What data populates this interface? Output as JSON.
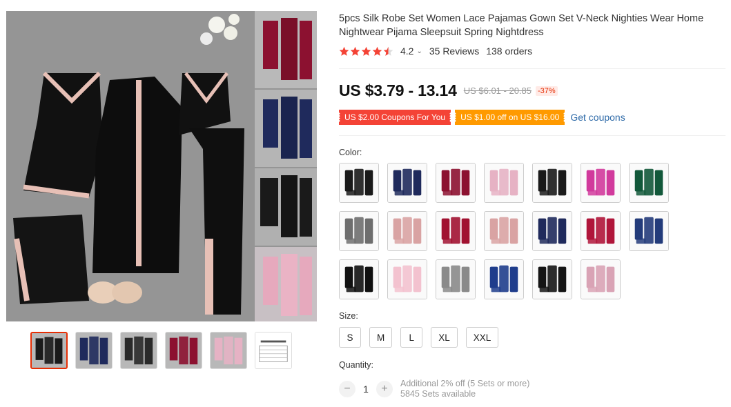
{
  "product": {
    "title": "5pcs Silk Robe Set Women Lace Pajamas Gown Set V-Neck Nighties Wear Home Nightwear Pijama Sleepsuit Spring Nightdress",
    "rating": "4.2",
    "reviews": "35 Reviews",
    "orders": "138 orders",
    "price": "US $3.79 - 13.14",
    "old_price": "US $6.01 - 20.85",
    "discount": "-37%"
  },
  "coupons": {
    "coupon1": "US $2.00 Coupons For You",
    "coupon2": "US $1.00 off on US $16.00",
    "get_coupons": "Get coupons"
  },
  "color": {
    "label": "Color:",
    "swatches": [
      "#1a1a1a",
      "#1f2a5c",
      "#8c1130",
      "#e6b2c4",
      "#1a1a1a",
      "#d13a9c",
      "#12583a",
      "#6e6e6e",
      "#d9a3a3",
      "#a11231",
      "#d9a3a3",
      "#1f2a5c",
      "#b0153a",
      "#233b7a",
      "#111111",
      "#f3c2cf",
      "#8a8a8a",
      "#1f3d8c",
      "#151515",
      "#d9a3b5"
    ]
  },
  "size": {
    "label": "Size:",
    "options": [
      "S",
      "M",
      "L",
      "XL",
      "XXL"
    ]
  },
  "quantity": {
    "label": "Quantity:",
    "minus": "−",
    "plus": "+",
    "value": "1",
    "discount_note": "Additional 2% off (5 Sets or more)",
    "available": "5845 Sets available"
  },
  "thumbnails": [
    "#1a1a1a",
    "#1f2a5c",
    "#2a2a2a",
    "#8c1130",
    "#e6b2c4",
    "#ffffff"
  ],
  "colors": {
    "accent": "#e62e04",
    "star": "#f44336",
    "coupon_red": "#f44336",
    "coupon_orange": "#ff9a00",
    "link": "#2e6aa8"
  }
}
